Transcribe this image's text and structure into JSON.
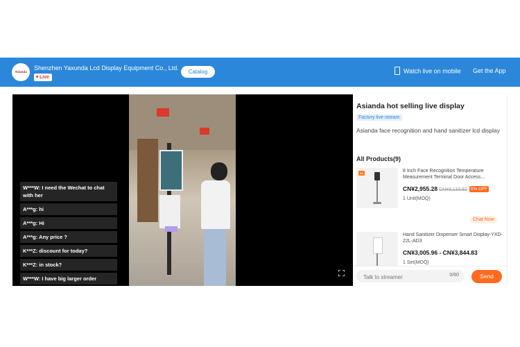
{
  "header": {
    "logo_text": "Asianda",
    "company": "Shenzhen Yaxunda Lcd Display Equipment Co., Ltd.",
    "live_label": "Live",
    "catalog_label": "Catalog",
    "watch_mobile_label": "Watch live on mobile",
    "get_app_label": "Get the App"
  },
  "video": {
    "chat": [
      "W***W: I need the Wechat to chat with her",
      "A***g: hi",
      "A***g: Hi",
      "A***g: Any price ?",
      "K***Z: discount for today?",
      "K***Z: in stock?",
      "W***W: I have big larger order"
    ]
  },
  "panel": {
    "title": "Asianda hot selling live display",
    "tag": "Factory live-stream",
    "description": "Asianda face recognition and hand sanitizer lcd display",
    "all_products_label": "All Products(9)",
    "products": [
      {
        "name": "8 Inch Face Recognition Temperature Measurement Terminal Door Access...",
        "price": "CN¥2,955.28",
        "old_price": "CN¥3,110.82",
        "discount": "5% OFF",
        "moq": "1 Unit(MOQ)",
        "chat_now": "Chat Now"
      },
      {
        "name": "Hand Sanitizer Dispenser Smart Display-YXD-22L-AD3",
        "price": "CN¥3,005.96 - CN¥3,844.83",
        "moq": "1 Set(MOQ)"
      }
    ],
    "input_placeholder": "Talk to streamer",
    "counter": "0/60",
    "send_label": "Send"
  }
}
